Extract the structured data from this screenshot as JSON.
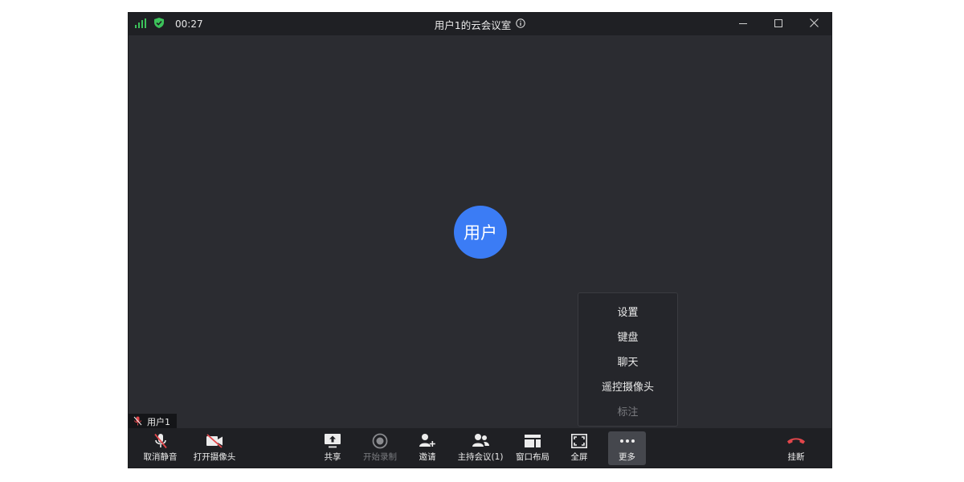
{
  "titlebar": {
    "timer": "00:27",
    "title": "用户1的云会议室",
    "icons": [
      "signal-icon",
      "shield-check-icon",
      "info-icon",
      "minimize-icon",
      "maximize-icon",
      "close-icon"
    ]
  },
  "stage": {
    "avatar_text": "用户",
    "name_tag": "用户1"
  },
  "more_menu": {
    "items": [
      {
        "label": "设置",
        "enabled": true
      },
      {
        "label": "键盘",
        "enabled": true
      },
      {
        "label": "聊天",
        "enabled": true
      },
      {
        "label": "遥控摄像头",
        "enabled": true
      },
      {
        "label": "标注",
        "enabled": false
      }
    ]
  },
  "toolbar": {
    "unmute": "取消静音",
    "camera": "打开摄像头",
    "share": "共享",
    "record": "开始录制",
    "invite": "邀请",
    "host": "主持会议(1)",
    "layout": "窗口布局",
    "fullscreen": "全屏",
    "more": "更多",
    "hangup": "挂断"
  },
  "colors": {
    "accent": "#3b7cf5",
    "signal": "#3cc25a",
    "hangup": "#e2464b",
    "muted": "#e2464b"
  }
}
